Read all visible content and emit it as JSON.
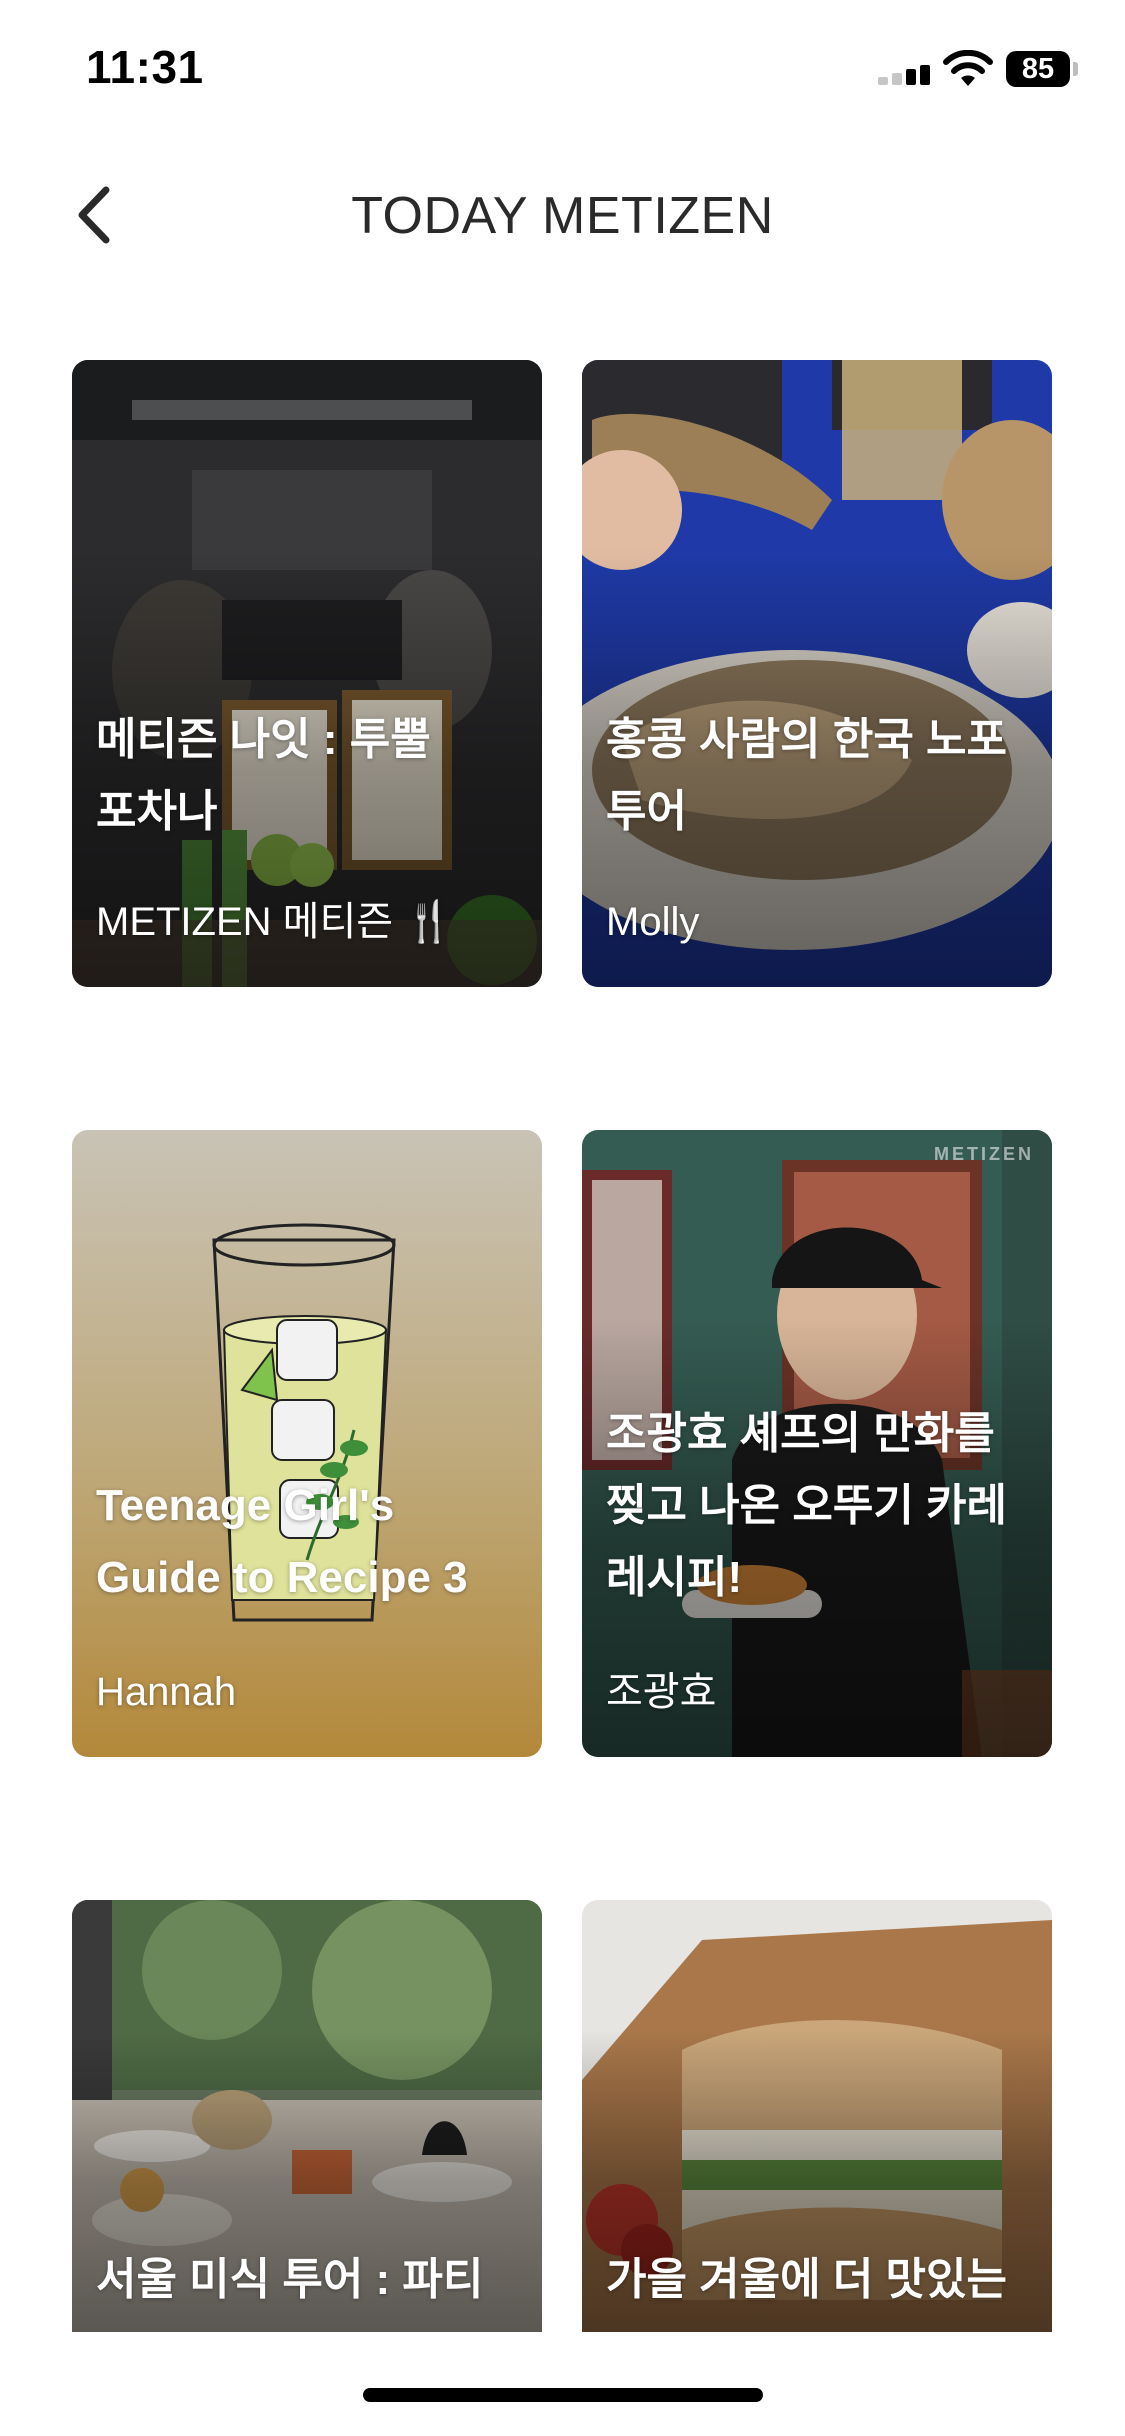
{
  "status_bar": {
    "time": "11:31",
    "battery_level": "85",
    "battery_percent": 85
  },
  "header": {
    "title": "TODAY METIZEN",
    "back_icon": "chevron-left-icon"
  },
  "cards": [
    {
      "title": "메티즌 나잇 : 투뿔 포차나",
      "author": "METIZEN 메티즌 🍴",
      "image": "restaurant-party-photo"
    },
    {
      "title": "홍콩 사람의 한국 노포 투어",
      "author": "Molly",
      "image": "grilled-fish-photo"
    },
    {
      "title": "Teenage Girl's Guide to Recipe 3",
      "author": "Hannah",
      "image": "lemonade-glass-illustration"
    },
    {
      "title": "조광효 셰프의 만화를 찢고 나온 오뚜기 카레 레시피!",
      "author": "조광효",
      "image": "chef-portrait-photo",
      "watermark": "METIZEN"
    },
    {
      "title": "서울 미식 투어 : 파티",
      "author": "",
      "image": "dessert-table-photo"
    },
    {
      "title": "가을 겨울에 더 맛있는",
      "author": "",
      "image": "sandwich-photo"
    }
  ],
  "colors": {
    "background": "#ffffff",
    "title_text": "#2a2a2a",
    "card_text": "#ffffff",
    "card3_tint": "#b08a3c"
  }
}
